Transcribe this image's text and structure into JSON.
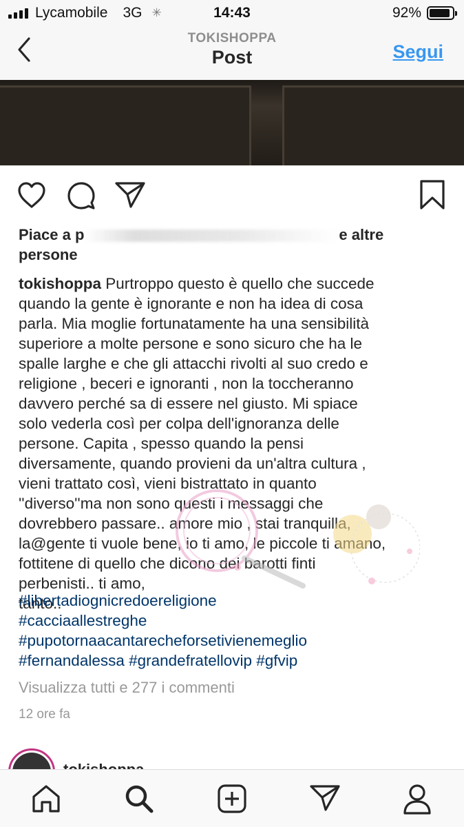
{
  "status_bar": {
    "carrier": "Lycamobile",
    "network": "3G",
    "time": "14:43",
    "battery": "92%",
    "battery_level": 0.92
  },
  "header": {
    "username": "TOKISHOPPA",
    "title": "Post",
    "follow_label": "Segui"
  },
  "icons": {
    "back": "chevron-left-icon",
    "like": "heart-icon",
    "comment": "comment-icon",
    "share": "send-icon",
    "save": "bookmark-icon",
    "home": "home-icon",
    "search": "search-icon",
    "add": "add-post-icon",
    "activity": "send-icon",
    "profile": "profile-icon"
  },
  "colors": {
    "link": "#3897f0",
    "hashtag": "#003569",
    "muted": "#999999",
    "avatar_ring": "#c13584"
  },
  "post": {
    "likes_prefix": "Piace a p",
    "likes_suffix": "e altre",
    "likes_line2": "persone",
    "author": "tokishoppa",
    "caption": " Purtroppo questo è quello che succede\nquando la gente è ignorante e non ha idea di cosa\nparla. Mia moglie fortunatamente ha una sensibilità\nsuperiore a molte persone e sono sicuro che ha le\nspalle larghe e che gli attacchi rivolti al suo credo e\nreligione , beceri e ignoranti , non la toccheranno\ndavvero perché sa di essere nel giusto. Mi spiace\nsolo vederla così per colpa dell'ignoranza delle\npersone. Capita , spesso quando la pensi\ndiversamente, quando provieni da un'altra cultura ,\nvieni trattato così, vieni bistrattato in quanto\n''diverso''ma non sono questi i messaggi che\ndovrebbero passare.. amore mio , stai tranquilla,\nla@gente ti vuole bene, io ti amo, le piccole ti amano,\nfottitene di quello che dicono dei barotti finti\nperbenisti.. ti amo,\ntanto..",
    "hashtags": "                #libertadiognicredoereligione\n#cacciaallestreghe\n#pupotornaacantarecheforsetivienemeglio\n#fernandalessa #grandefratellovip #gfvip",
    "view_comments": "Visualizza tutti e 277 i commenti",
    "time_ago": "12 ore fa",
    "next_username": "tokishoppa"
  }
}
